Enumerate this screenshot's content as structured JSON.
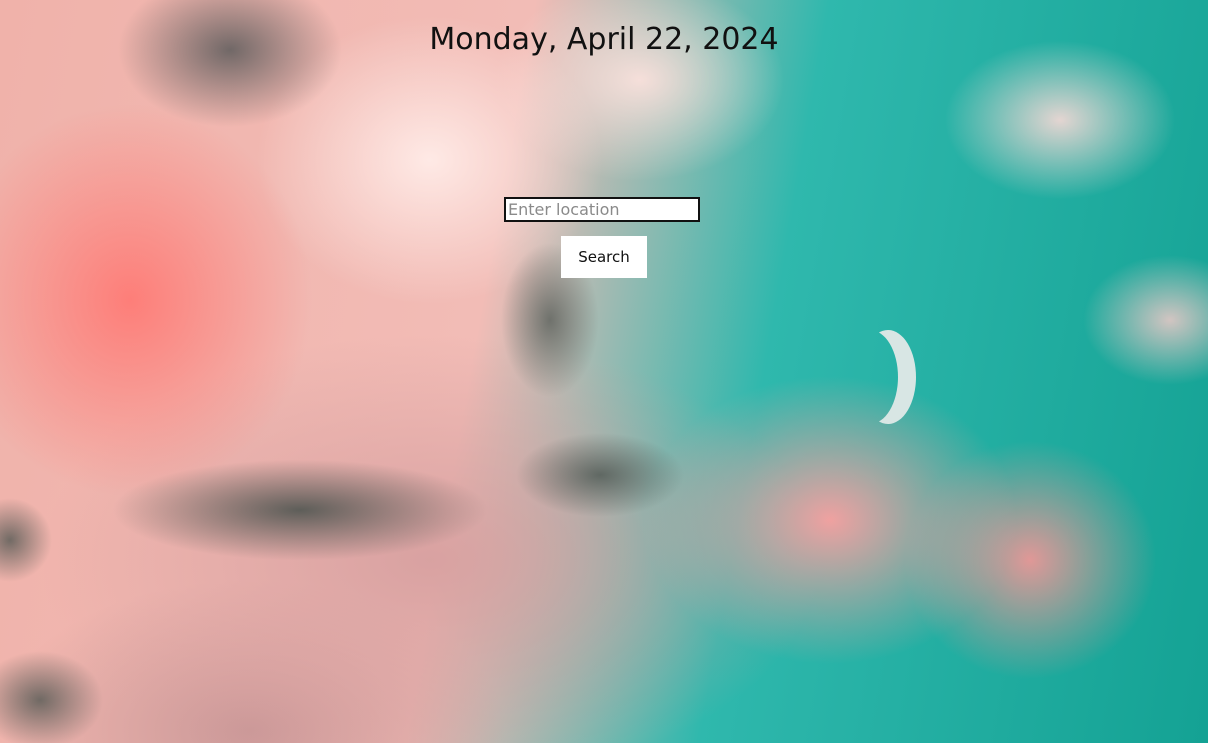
{
  "header": {
    "date": "Monday, April 22, 2024"
  },
  "search": {
    "placeholder": "Enter location",
    "value": "",
    "button_label": "Search"
  },
  "background": {
    "description_icon": "sky-clouds-moon-image",
    "colors": {
      "sky_teal": "#1aa898",
      "cloud_pink": "#f2a8a4",
      "cloud_light": "#fbe6e3"
    }
  }
}
